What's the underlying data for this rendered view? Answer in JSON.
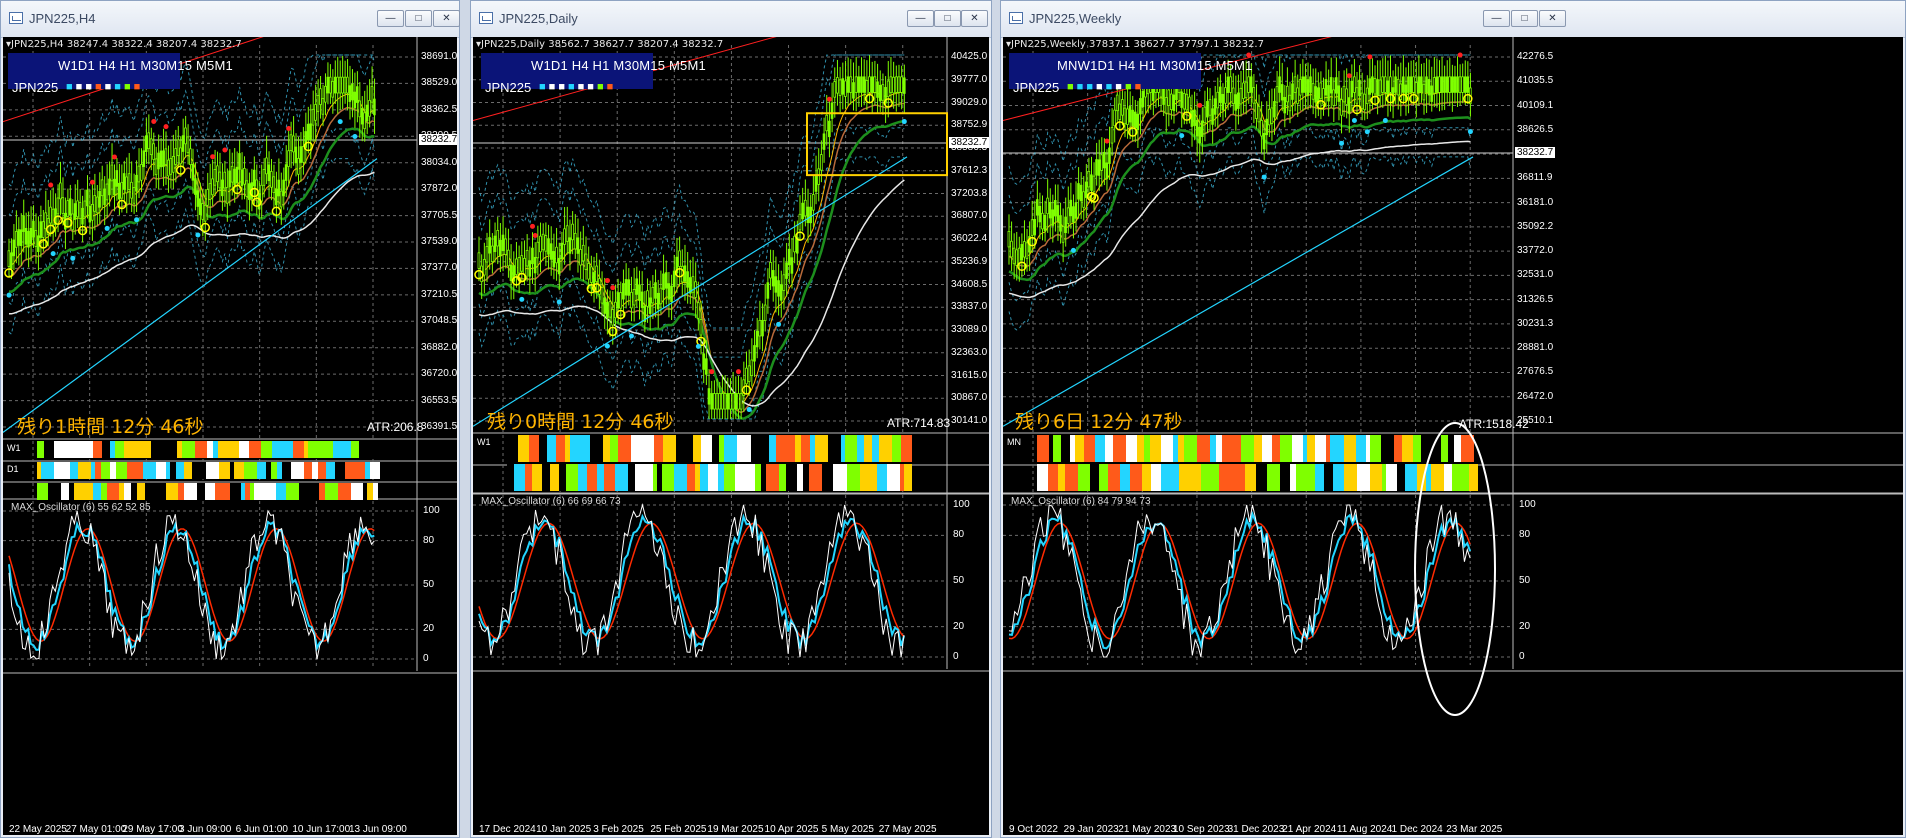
{
  "windows": [
    {
      "title": "JPN225,H4",
      "header": "JPN225,H4  38247.4 38322.4 38207.4 38232.7",
      "tf_label": "W1D1 H4 H1 M30M15 M5M1",
      "symbol": "JPN225",
      "dot_colors": [
        "#23d5ff",
        "#ffffff",
        "#ffffff",
        "#ff5a1a",
        "#ffffff",
        "#23d5ff",
        "#7fff00",
        "#ff5a1a"
      ],
      "remaining": "残り1時間 12分 46秒",
      "atr": "ATR:206.8",
      "current_price": "38232.7",
      "price_labels": [
        "38691.0",
        "38529.0",
        "38362.5",
        "38200.5",
        "38034.0",
        "37872.0",
        "37705.5",
        "37539.0",
        "37377.0",
        "37210.5",
        "37048.5",
        "36882.0",
        "36720.0",
        "36553.5",
        "36391.5"
      ],
      "strip_labels": [
        "W1",
        "D1",
        ""
      ],
      "oscillator": "MAX_Oscillator (6) 55 62 52 85",
      "osc_levels": [
        "100",
        "80",
        "50",
        "20",
        "0"
      ],
      "x_labels": [
        "22 May 2025",
        "27 May 01:00",
        "29 May 17:00",
        "3 Jun 09:00",
        "6 Jun 01:00",
        "10 Jun 17:00",
        "13 Jun 09:00"
      ]
    },
    {
      "title": "JPN225,Daily",
      "header": "JPN225,Daily  38562.7 38627.7 38207.4 38232.7",
      "tf_label": "W1D1 H4 H1 M30M15 M5M1",
      "symbol": "JPN225",
      "dot_colors": [
        "#23d5ff",
        "#ffffff",
        "#ffffff",
        "#23d5ff",
        "#ffffff",
        "#ffffff",
        "#7fff00",
        "#ff5a1a"
      ],
      "remaining": "残り0時間 12分 46秒",
      "atr": "ATR:714.83",
      "current_price": "38232.7",
      "price_labels": [
        "40425.0",
        "39777.0",
        "39029.0",
        "38752.9",
        "38586.3",
        "37612.3",
        "37203.8",
        "36807.0",
        "36022.4",
        "35236.9",
        "34608.5",
        "33837.0",
        "33089.0",
        "32363.0",
        "31615.0",
        "30867.0",
        "30141.0"
      ],
      "strip_labels": [
        "W1",
        ""
      ],
      "oscillator": "MAX_Oscillator (6) 66 69 66 73",
      "osc_levels": [
        "100",
        "80",
        "50",
        "20",
        "0"
      ],
      "x_labels": [
        "17 Dec 2024",
        "10 Jan 2025",
        "3 Feb 2025",
        "25 Feb 2025",
        "19 Mar 2025",
        "10 Apr 2025",
        "5 May 2025",
        "27 May 2025"
      ]
    },
    {
      "title": "JPN225,Weekly",
      "header": "JPN225,Weekly  37837.1 38627.7 37797.1 38232.7",
      "tf_label": "MNW1D1 H4 H1 M30M15 M5M1",
      "symbol": "JPN225",
      "dot_colors": [
        "#7fff00",
        "#23d5ff",
        "#23d5ff",
        "#ffffff",
        "#23d5ff",
        "#ffffff",
        "#7fff00",
        "#ff5a1a"
      ],
      "remaining": "残り6日 12分 47秒",
      "atr": "ATR:1518.42",
      "current_price": "38232.7",
      "price_labels": [
        "42276.5",
        "41035.5",
        "40109.1",
        "38626.5",
        "37422.0",
        "36811.9",
        "36181.0",
        "35092.2",
        "33772.0",
        "32531.0",
        "31326.5",
        "30231.3",
        "28881.0",
        "27676.5",
        "26472.0",
        "25510.1"
      ],
      "strip_labels": [
        "MN",
        ""
      ],
      "oscillator": "MAX_Oscillator (6) 84 79 94 73",
      "osc_levels": [
        "100",
        "80",
        "50",
        "20",
        "0"
      ],
      "x_labels": [
        "9 Oct 2022",
        "29 Jan 2023",
        "21 May 2023",
        "10 Sep 2023",
        "31 Dec 2023",
        "21 Apr 2024",
        "11 Aug 2024",
        "1 Dec 2024",
        "23 Mar 2025"
      ]
    }
  ],
  "window_buttons": {
    "minimize": "—",
    "maximize": "□",
    "close": "✕"
  },
  "colors": {
    "background": "#000000",
    "grid": "#6b6b6b",
    "candle": "#7fff00",
    "ema_fast": "#ffb400",
    "ema_mid": "#b86a3a",
    "ema_slow": "#1d8f1d",
    "ema_long": "#e8e8e8",
    "trend_cyan": "#23d5ff",
    "trend_red": "#ff2020",
    "bands": "#3bb3d6",
    "marker": "#ffff00",
    "osc_main": "#ffffff",
    "osc_signal": "#ff2a00",
    "osc_up": "#23d5ff",
    "osc_down": "#ffd000",
    "highlight": "#ffd000"
  }
}
